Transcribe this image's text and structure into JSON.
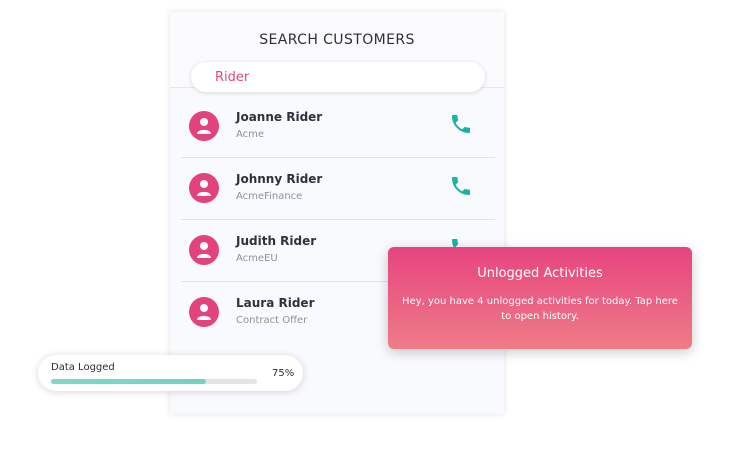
{
  "search": {
    "title": "SEARCH CUSTOMERS",
    "query": "Rider"
  },
  "customers": [
    {
      "name": "Joanne Rider",
      "company": "Acme",
      "call_icon": "phone-icon"
    },
    {
      "name": "Johnny Rider",
      "company": "AcmeFinance",
      "call_icon": "phone-icon"
    },
    {
      "name": "Judith Rider",
      "company": "AcmeEU",
      "call_icon": "phone-icon"
    },
    {
      "name": "Laura Rider",
      "company": "Contract Offer",
      "call_icon": "phone-icon"
    }
  ],
  "data_logged": {
    "label": "Data Logged",
    "percent_label": "75%",
    "progress": 0.75
  },
  "notification": {
    "title": "Unlogged Activities",
    "message": "Hey, you have 4 unlogged activities for today. Tap here to open history."
  },
  "colors": {
    "accent": "#e3437d",
    "phone": "#19b3a4",
    "progress": "#74d5c5"
  }
}
